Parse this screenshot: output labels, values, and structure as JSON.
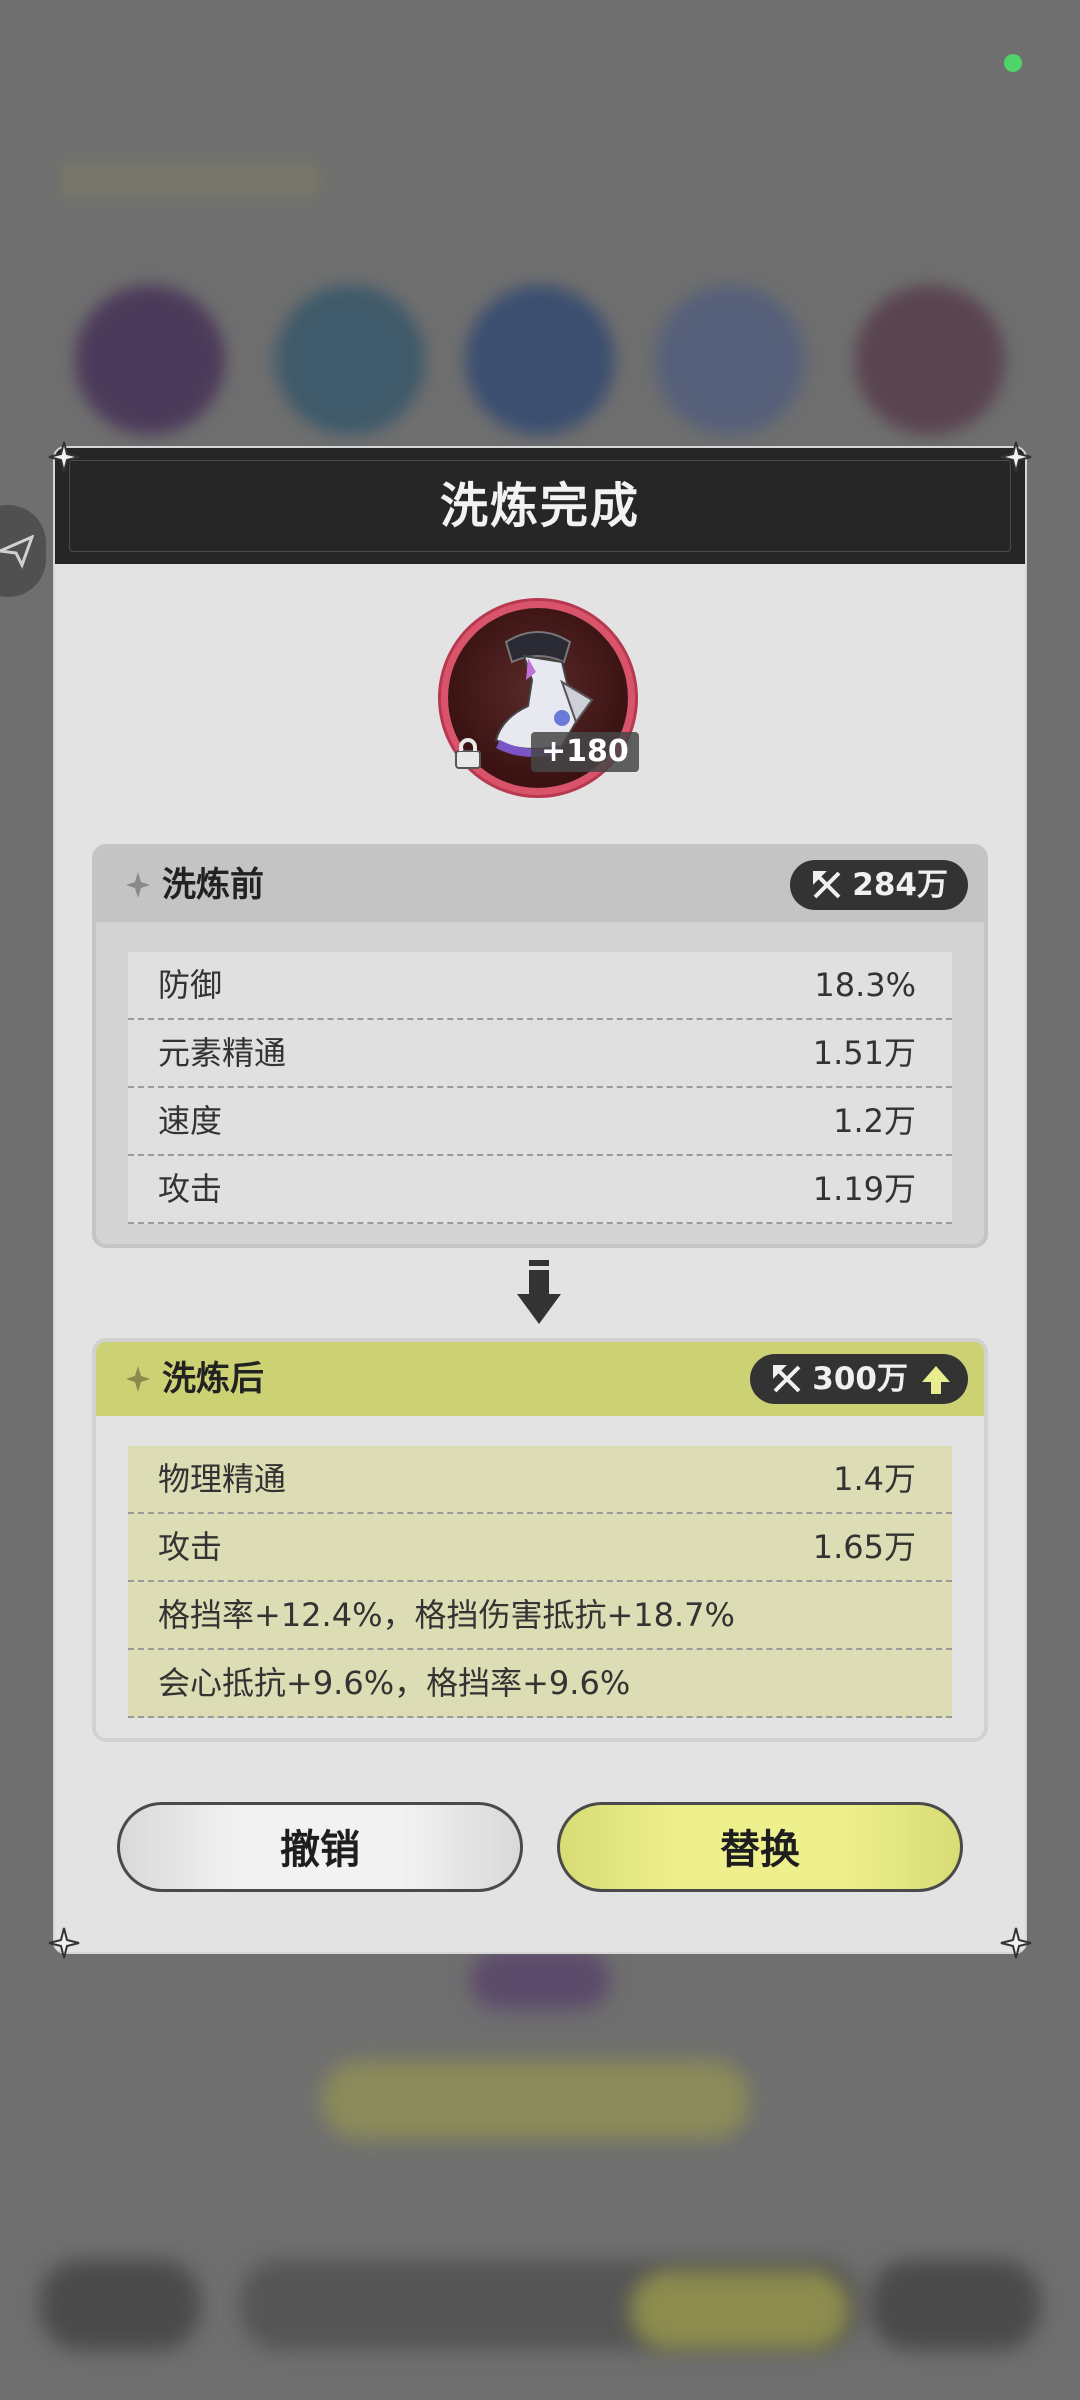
{
  "dialog": {
    "title": "洗炼完成",
    "equipment": {
      "level_badge": "+180",
      "icon": "boots-icon",
      "locked": true
    },
    "before": {
      "label": "洗炼前",
      "score": "284万",
      "stats": [
        {
          "name": "防御",
          "value": "18.3%"
        },
        {
          "name": "元素精通",
          "value": "1.51万"
        },
        {
          "name": "速度",
          "value": "1.2万"
        },
        {
          "name": "攻击",
          "value": "1.19万"
        }
      ]
    },
    "after": {
      "label": "洗炼后",
      "score": "300万",
      "stats": [
        {
          "name": "物理精通",
          "value": "1.4万"
        },
        {
          "name": "攻击",
          "value": "1.65万"
        },
        {
          "name": "格挡率+12.4%，格挡伤害抵抗+18.7%",
          "value": ""
        },
        {
          "name": "会心抵抗+9.6%，格挡率+9.6%",
          "value": ""
        }
      ]
    },
    "buttons": {
      "cancel": "撤销",
      "replace": "替换"
    }
  },
  "colors": {
    "accent_yellow": "#ccd274",
    "header_dark": "#262626",
    "status_dot": "#4fd46a"
  }
}
